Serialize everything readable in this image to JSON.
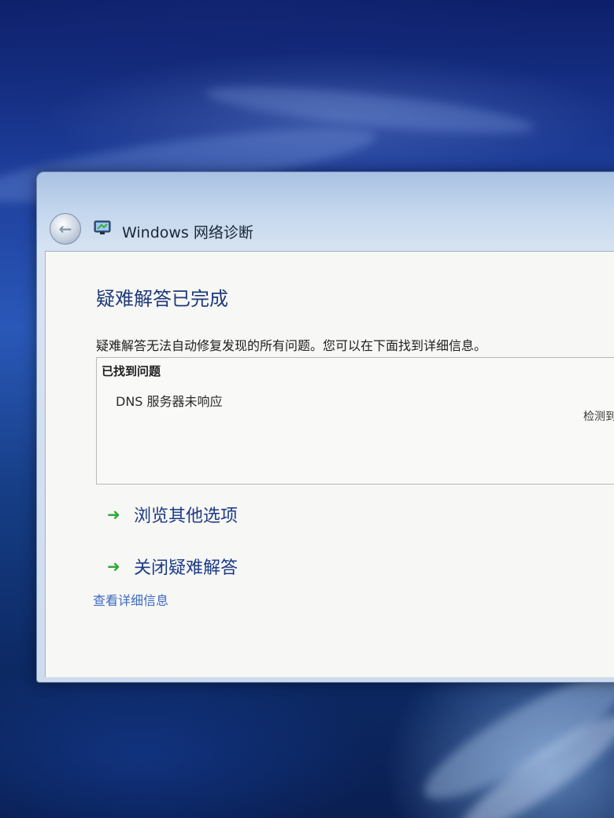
{
  "window": {
    "title": "Windows 网络诊断",
    "icon": "network-diagnostics-icon",
    "back_icon": "back-arrow-icon"
  },
  "main": {
    "heading": "疑难解答已完成",
    "description": "疑难解答无法自动修复发现的所有问题。您可以在下面找到详细信息。",
    "problems": {
      "header": "已找到问题",
      "items": [
        {
          "name": "DNS 服务器未响应",
          "status": "检测到"
        }
      ]
    },
    "options": [
      {
        "label": "浏览其他选项",
        "icon": "green-arrow-icon"
      },
      {
        "label": "关闭疑难解答",
        "icon": "green-arrow-icon"
      }
    ],
    "details_link": "查看详细信息"
  },
  "colors": {
    "heading": "#1f3a7a",
    "link": "#3d6ac2",
    "arrow": "#2fa83a"
  }
}
